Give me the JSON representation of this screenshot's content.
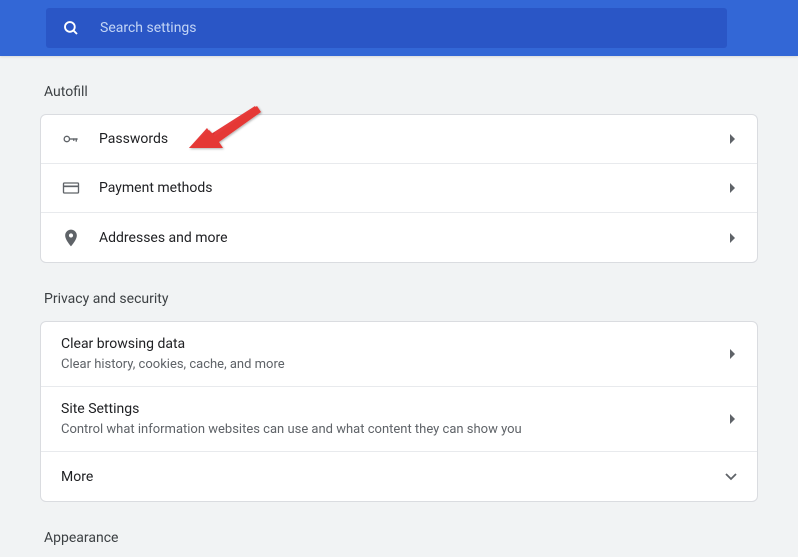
{
  "search": {
    "placeholder": "Search settings"
  },
  "sections": {
    "autofill": {
      "title": "Autofill",
      "passwords": "Passwords",
      "payment": "Payment methods",
      "addresses": "Addresses and more"
    },
    "privacy": {
      "title": "Privacy and security",
      "clear_title": "Clear browsing data",
      "clear_sub": "Clear history, cookies, cache, and more",
      "site_title": "Site Settings",
      "site_sub": "Control what information websites can use and what content they can show you",
      "more": "More"
    },
    "appearance": {
      "title": "Appearance"
    }
  }
}
